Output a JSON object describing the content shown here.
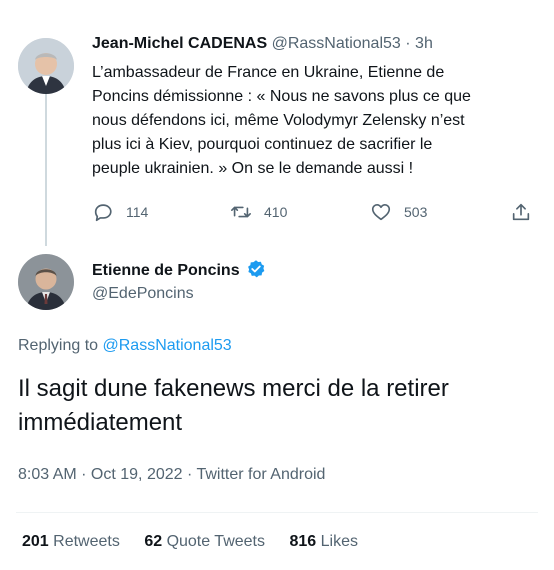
{
  "parent_tweet": {
    "name": "Jean-Michel CADENAS",
    "handle": "@RassNational53",
    "separator": "·",
    "time": "3h",
    "text_lines": [
      "L’ambassadeur de France en Ukraine, Etienne de",
      "Poncins démissionne : « Nous ne savons plus ce que",
      "nous défendons ici, même Volodymyr Zelensky n’est",
      "plus ici à Kiev, pourquoi continuez de sacrifier le",
      "peuple ukrainien. » On se le demande aussi !"
    ],
    "replies": "114",
    "retweets": "410",
    "likes": "503"
  },
  "main_tweet": {
    "name": "Etienne de Poncins",
    "handle": "@EdePoncins",
    "verified": true,
    "replying_prefix": "Replying to",
    "replying_to": "@RassNational53",
    "text_lines": [
      "Il sagit dune fakenews merci de la retirer",
      "immédiatement"
    ],
    "timestamp": "8:03 AM · Oct 19, 2022 · Twitter for Android",
    "retweets_count": "201",
    "retweets_label": "Retweets",
    "quotes_count": "62",
    "quotes_label": "Quote Tweets",
    "likes_count": "816",
    "likes_label": "Likes"
  },
  "colors": {
    "accent": "#1d9bf0",
    "muted": "#536471",
    "text": "#0f1419"
  }
}
